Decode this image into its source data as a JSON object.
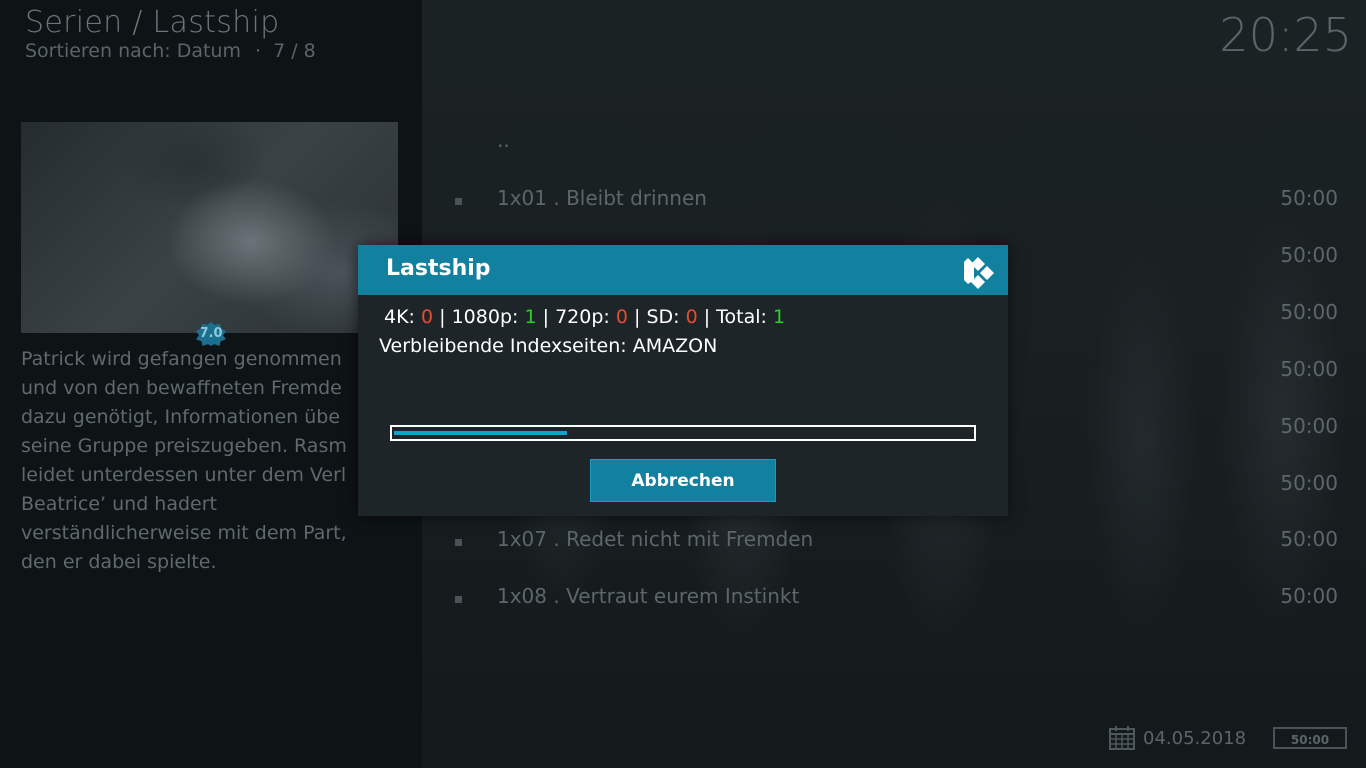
{
  "header": {
    "title": "Serien / Lastship",
    "sort_label": "Sortieren nach: Datum",
    "separator": "·",
    "position": "7 / 8",
    "clock": "20:25"
  },
  "info": {
    "rating": "7.0",
    "plot_lines": [
      "Patrick wird gefangen genommen",
      "und von den bewaffneten Fremde",
      "dazu genötigt, Informationen übe",
      "seine Gruppe preiszugeben. Rasm",
      "leidet unterdessen unter dem Verl",
      "Beatrice’ und hadert",
      "verständlicherweise mit dem Part,",
      "den er dabei spielte."
    ]
  },
  "list": {
    "parent": "..",
    "episodes": [
      {
        "title": "1x01 . Bleibt drinnen",
        "duration": "50:00"
      },
      {
        "title": "",
        "duration": "50:00"
      },
      {
        "title": "",
        "duration": "50:00"
      },
      {
        "title": "",
        "duration": "50:00"
      },
      {
        "title": "",
        "duration": "50:00"
      },
      {
        "title": "",
        "duration": "50:00"
      },
      {
        "title": "1x07 . Redet nicht mit Fremden",
        "duration": "50:00"
      },
      {
        "title": "1x08 . Vertraut eurem Instinkt",
        "duration": "50:00"
      }
    ]
  },
  "footer": {
    "date": "04.05.2018",
    "duration": "50:00"
  },
  "dialog": {
    "title": "Lastship",
    "stats": {
      "k4_label": "4K:",
      "k4_value": "0",
      "p1080_label": "1080p:",
      "p1080_value": "1",
      "p720_label": "720p:",
      "p720_value": "0",
      "sd_label": "SD:",
      "sd_value": "0",
      "total_label": "Total:",
      "total_value": "1",
      "sep": "|"
    },
    "index_line": "Verbleibende Indexseiten: AMAZON",
    "progress": 0.3,
    "cancel_label": "Abbrechen",
    "colors": {
      "accent": "#12809f",
      "zero": "#e74c2f",
      "nonzero": "#27d320"
    }
  }
}
